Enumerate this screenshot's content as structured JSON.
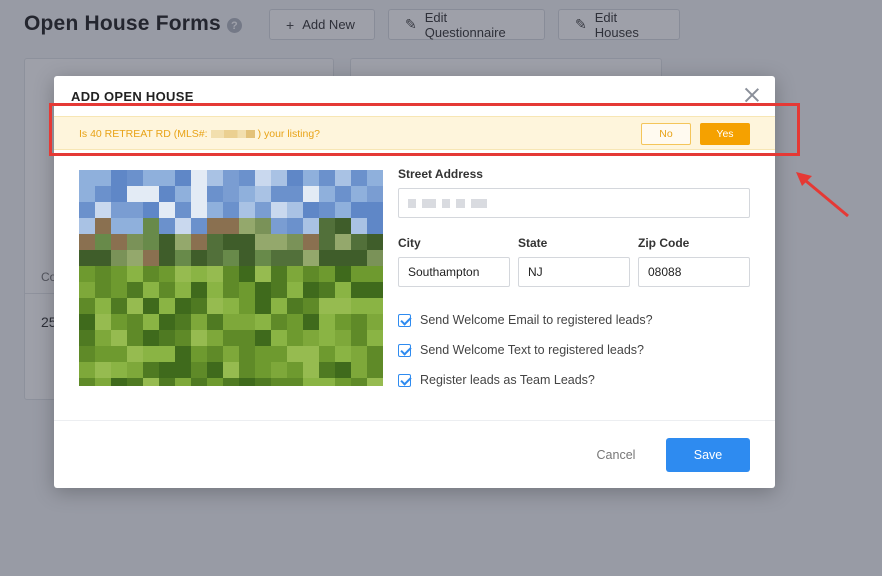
{
  "page": {
    "title": "Open House Forms",
    "help_glyph": "?",
    "buttons": [
      {
        "icon": "plus-icon",
        "glyph": "+",
        "label": "Add New"
      },
      {
        "icon": "edit-icon",
        "glyph": "✎",
        "label": "Edit Questionnaire"
      },
      {
        "icon": "edit-icon",
        "glyph": "✎",
        "label": "Edit Houses"
      }
    ],
    "card": {
      "partial_label": "Co",
      "partial_number": "25"
    }
  },
  "modal": {
    "title": "ADD OPEN HOUSE",
    "listing_prompt": {
      "prefix": "Is 40 RETREAT RD (MLS#: ",
      "suffix": ") your listing?",
      "no_label": "No",
      "yes_label": "Yes"
    },
    "street_address": {
      "label": "Street Address"
    },
    "city": {
      "label": "City",
      "value": "Southampton"
    },
    "state": {
      "label": "State",
      "value": "NJ"
    },
    "zip": {
      "label": "Zip Code",
      "value": "08088"
    },
    "options": [
      {
        "label": "Send Welcome Email to registered leads?",
        "checked": true
      },
      {
        "label": "Send Welcome Text to registered leads?",
        "checked": true
      },
      {
        "label": "Register leads as Team Leads?",
        "checked": true
      }
    ],
    "cancel_label": "Cancel",
    "save_label": "Save"
  },
  "colors": {
    "primary": "#2e8bf0",
    "warning": "#f5a100",
    "annotation": "#e53935"
  }
}
